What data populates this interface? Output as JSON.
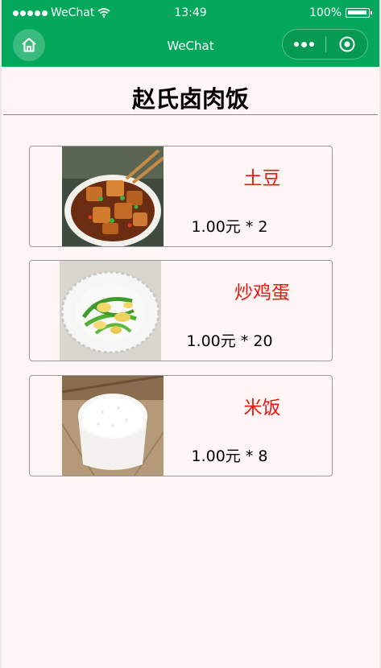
{
  "status_bar": {
    "carrier": "WeChat",
    "time": "13:49",
    "battery_percent": "100%"
  },
  "nav_bar": {
    "title": "WeChat",
    "home_icon": "home-icon",
    "more_icon": "more-dots-icon",
    "close_icon": "target-close-icon"
  },
  "page": {
    "title": "赵氏卤肉饭"
  },
  "items": [
    {
      "name": "土豆",
      "price": "1.00元 * 2",
      "image": "braised-potato-dish"
    },
    {
      "name": "炒鸡蛋",
      "price": "1.00元 * 20",
      "image": "scrambled-egg-peppers-dish"
    },
    {
      "name": "米饭",
      "price": "1.00元 * 8",
      "image": "rice-bowl"
    }
  ],
  "colors": {
    "brand_green": "#05a85a",
    "item_name_red": "#e8170f",
    "page_background": "#fff5f4"
  }
}
